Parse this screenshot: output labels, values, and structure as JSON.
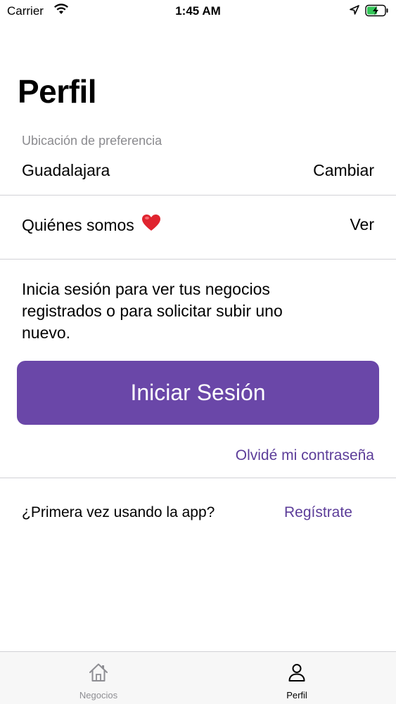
{
  "status_bar": {
    "carrier": "Carrier",
    "time": "1:45 AM"
  },
  "page": {
    "title": "Perfil"
  },
  "location": {
    "caption": "Ubicación de preferencia",
    "city": "Guadalajara",
    "change_label": "Cambiar"
  },
  "about": {
    "label": "Quiénes somos",
    "view_label": "Ver"
  },
  "auth": {
    "prompt": "Inicia sesión para ver tus negocios registrados o para solicitar subir uno nuevo.",
    "login_button": "Iniciar Sesión",
    "forgot_link": "Olvidé mi contraseña",
    "first_time_text": "¿Primera vez usando la app?",
    "register_link": "Regístrate"
  },
  "tab_bar": {
    "tabs": [
      {
        "label": "Negocios",
        "icon": "home-icon",
        "active": false
      },
      {
        "label": "Perfil",
        "icon": "person-icon",
        "active": true
      }
    ]
  },
  "colors": {
    "accent": "#6a47a8",
    "link": "#5c3d99",
    "tab_inactive": "#8e8e93"
  }
}
